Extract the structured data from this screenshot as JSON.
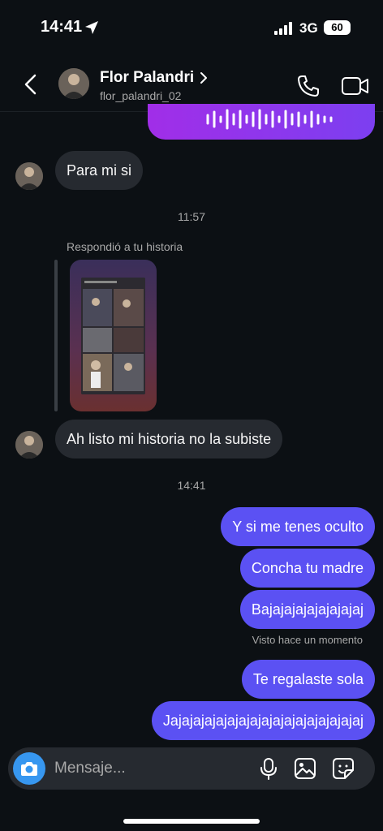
{
  "status_bar": {
    "time": "14:41",
    "network": "3G",
    "battery": "60"
  },
  "header": {
    "name": "Flor Palandri",
    "username": "flor_palandri_02"
  },
  "messages": {
    "incoming_1": "Para mi si",
    "timestamp_1": "11:57",
    "reply_label": "Respondió a tu historia",
    "incoming_2": "Ah listo mi historia no la subiste",
    "timestamp_2": "14:41",
    "outgoing": [
      "Y si me tenes oculto",
      "Concha tu madre",
      "Bajajajajajajajajaj",
      "Te regalaste sola",
      "Jajajajajajajajajajajajajajajajajaj"
    ],
    "seen": "Visto hace un momento"
  },
  "composer": {
    "placeholder": "Mensaje..."
  },
  "icons": {
    "back": "chevron-left",
    "phone": "phone",
    "video": "video-camera",
    "camera": "camera",
    "mic": "microphone",
    "gallery": "image",
    "sticker": "sticker"
  },
  "colors": {
    "background": "#0c1014",
    "incoming_bubble": "#262a30",
    "outgoing_bubble": "#5b51f3",
    "voice_bubble": "#a12ee8",
    "accent": "#3797f0"
  }
}
